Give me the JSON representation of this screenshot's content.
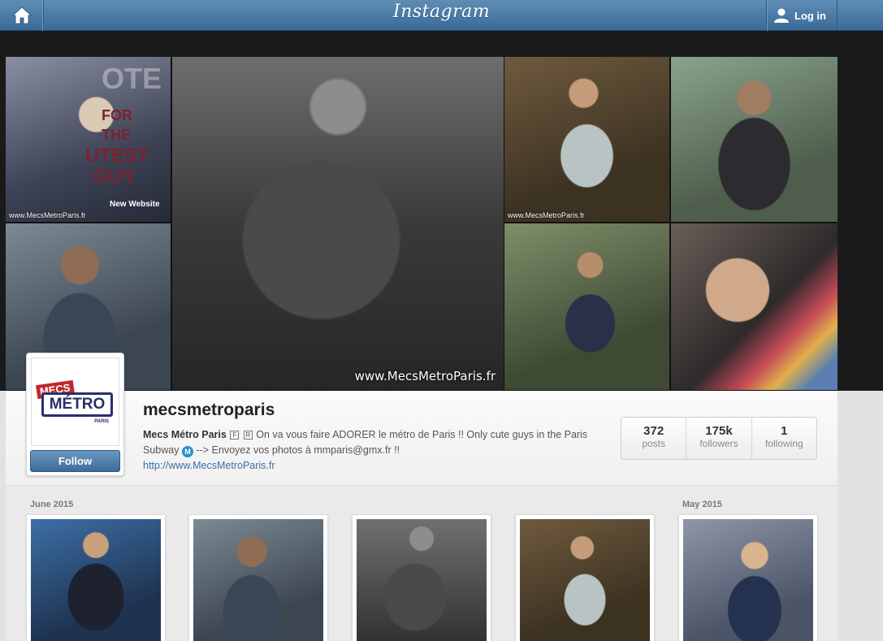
{
  "header": {
    "brand": "Instagram",
    "home_icon": "home-icon",
    "login_label": "Log in",
    "login_icon": "user-icon"
  },
  "hero": {
    "tiles": [
      {
        "watermark": "www.MecsMetroParis.fr"
      },
      {
        "watermark": "www.MecsMetroParis.fr"
      },
      {
        "watermark": "www.MecsMetroParis.fr"
      }
    ],
    "poster_text": [
      "OTE",
      "FOR",
      "THE",
      "UTEST",
      "GUY",
      "New Website"
    ]
  },
  "profile": {
    "avatar_text": {
      "mecs": "MECS",
      "metro": "MÉTRO",
      "paris": "PARIS"
    },
    "follow_label": "Follow",
    "username": "mecsmetroparis",
    "full_name": "Mecs Métro Paris",
    "bio_icon_f": "F",
    "bio_icon_r": "R",
    "bio_text_1": " On va vous faire ADORER le métro de Paris !! Only cute guys in the Paris Subway ",
    "bio_metro_icon": "M",
    "bio_text_2": " --> Envoyez vos photos à mmparis@gmx.fr !!",
    "website": "http://www.MecsMetroParis.fr"
  },
  "stats": [
    {
      "value": "372",
      "label": "posts"
    },
    {
      "value": "175k",
      "label": "followers"
    },
    {
      "value": "1",
      "label": "following"
    }
  ],
  "feed": {
    "months": [
      "June 2015",
      "May 2015"
    ]
  },
  "colors": {
    "header": "#3f6f9c",
    "follow": "#4a78a6",
    "link": "#3b6fa1"
  }
}
